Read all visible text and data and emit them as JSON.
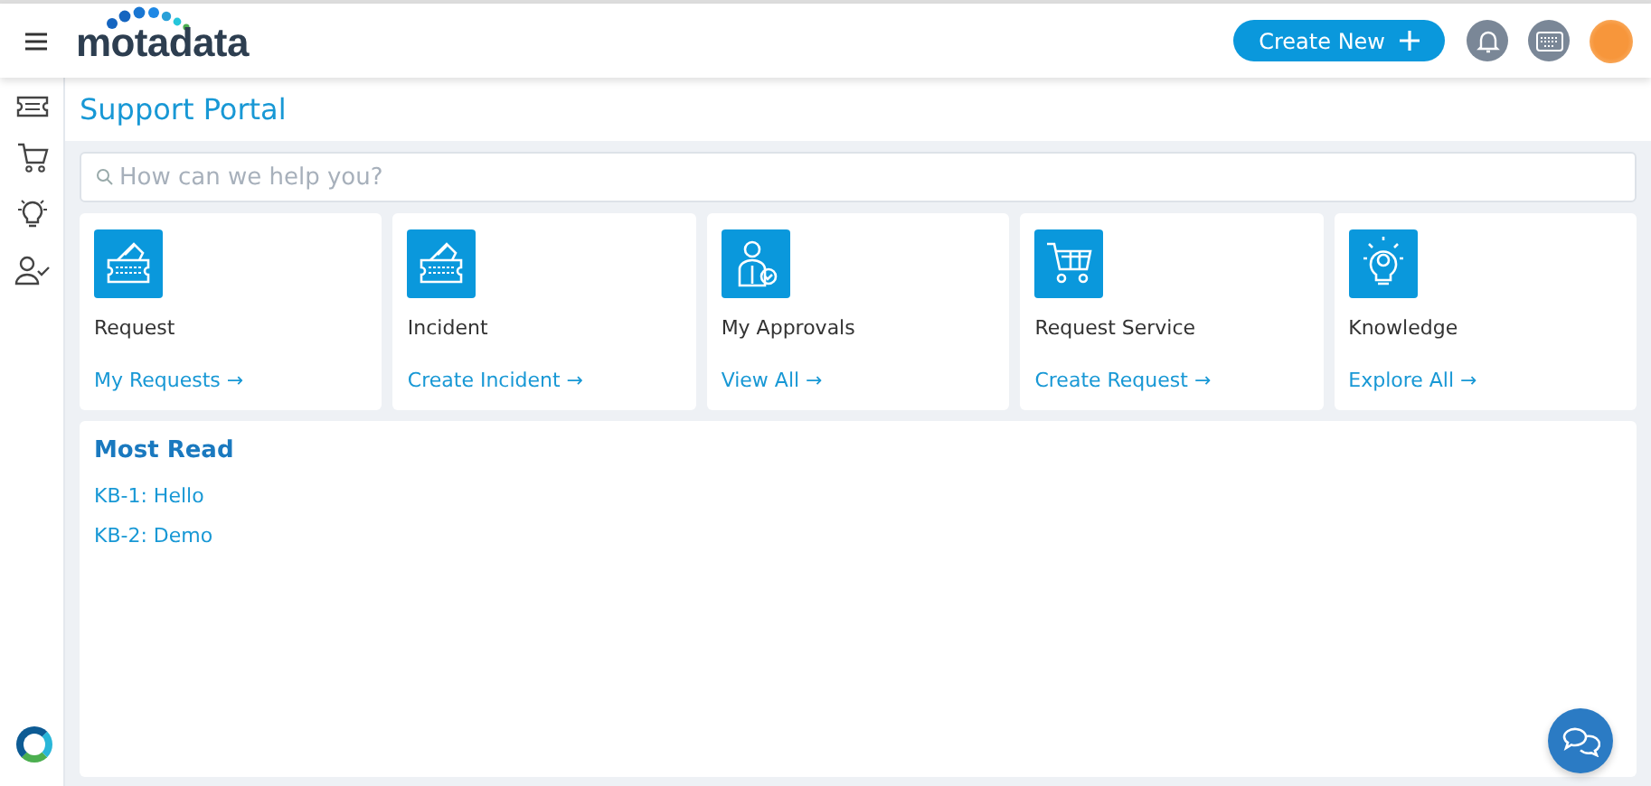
{
  "header": {
    "logo": "motadata",
    "create_button": "Create New"
  },
  "sidebar": {
    "items": [
      {
        "kind": "ticket"
      },
      {
        "kind": "cart"
      },
      {
        "kind": "bulb"
      },
      {
        "kind": "user"
      }
    ]
  },
  "page_title": "Support Portal",
  "search": {
    "placeholder": "How can we help you?"
  },
  "cards": [
    {
      "kind": "ticket",
      "title": "Request",
      "link": "My Requests →"
    },
    {
      "kind": "ticket",
      "title": "Incident",
      "link": "Create Incident →"
    },
    {
      "kind": "person",
      "title": "My Approvals",
      "link": "View All →"
    },
    {
      "kind": "cart",
      "title": "Request Service",
      "link": "Create Request →"
    },
    {
      "kind": "bulb",
      "title": "Knowledge",
      "link": "Explore All →"
    }
  ],
  "most_read": {
    "title": "Most Read",
    "items": [
      "KB-1: Hello",
      "KB-2: Demo"
    ]
  }
}
